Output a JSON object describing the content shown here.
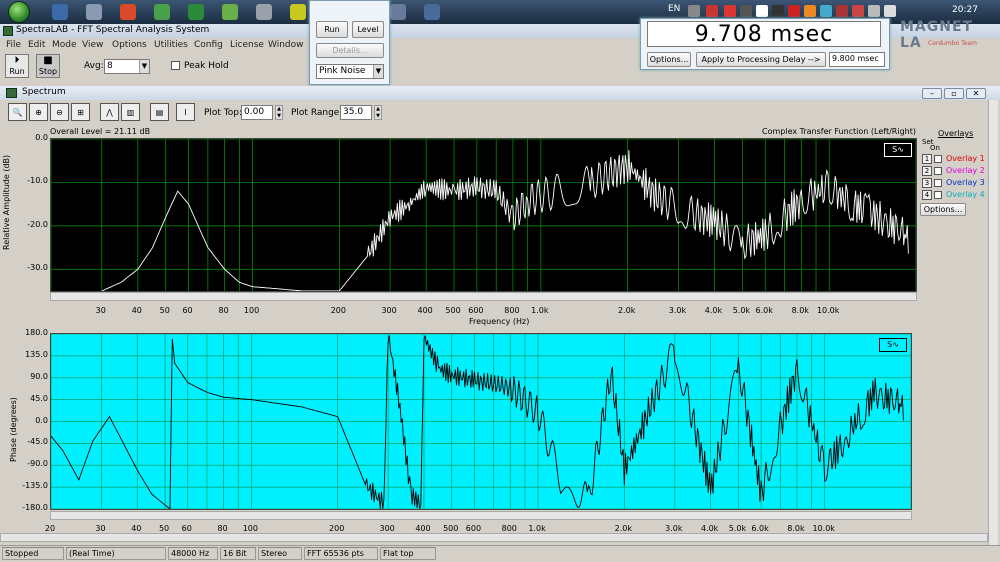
{
  "taskbar": {
    "lang": "EN",
    "clock": "20:27"
  },
  "brand": {
    "name": "MAGNET LA",
    "sub": "Cerdumbo Team"
  },
  "app": {
    "title": "SpectraLAB - FFT Spectral Analysis System"
  },
  "menu": [
    "File",
    "Edit",
    "Mode",
    "View",
    "Options",
    "Utilities",
    "Config",
    "License",
    "Window"
  ],
  "toolbar": {
    "run_label": "Run",
    "stop_label": "Stop",
    "avg_label": "Avg:",
    "avg_value": "8",
    "peak_hold_label": "Peak Hold"
  },
  "generator_popup": {
    "run_label": "Run",
    "level_label": "Level",
    "details_label": "Details...",
    "noise_value": "Pink Noise"
  },
  "delay_popup": {
    "value": "9.708 msec",
    "options_label": "Options...",
    "apply_label": "Apply to Processing Delay -->",
    "processing_delay": "9.800 msec"
  },
  "spectrum": {
    "title": "Spectrum",
    "plot_top_label": "Plot Top:",
    "plot_top_value": "0.00",
    "plot_range_label": "Plot Range:",
    "plot_range_value": "35.0",
    "overall_level": "Overall Level = 21.11 dB",
    "mode_label": "Complex Transfer Function (Left/Right)",
    "overlays_title": "Overlays",
    "set_label": "Set",
    "on_label": "On",
    "overlays": [
      {
        "num": "1",
        "label": "Overlay 1",
        "color": "#e00000"
      },
      {
        "num": "2",
        "label": "Overlay 2",
        "color": "#e000e0"
      },
      {
        "num": "3",
        "label": "Overlay 3",
        "color": "#0030c0"
      },
      {
        "num": "4",
        "label": "Overlay 4",
        "color": "#00b0c0"
      }
    ],
    "options_label": "Options..."
  },
  "chart_data": [
    {
      "type": "line",
      "ylabel": "Relative Amplitude (dB)",
      "xlabel": "Frequency (Hz)",
      "ylim": [
        -35,
        0
      ],
      "xlim": [
        20,
        20000
      ],
      "x_scale": "log",
      "yticks": [
        "0.0",
        "-10.0",
        "-20.0",
        "-30.0"
      ],
      "xticks": [
        "30",
        "40",
        "50",
        "60",
        "80",
        "100",
        "200",
        "300",
        "400",
        "500",
        "600",
        "800",
        "1.0k",
        "2.0k",
        "3.0k",
        "4.0k",
        "5.0k",
        "6.0k",
        "8.0k",
        "10.0k"
      ],
      "background": "#000000",
      "line_color": "#ffffff",
      "grid_color": "#00a000",
      "series": [
        {
          "x": [
            30,
            35,
            40,
            45,
            50,
            55,
            60,
            70,
            80,
            90,
            100,
            150,
            200,
            250,
            300,
            350,
            400,
            500,
            600,
            700,
            800,
            900,
            1000,
            1500,
            2000,
            2500,
            3000,
            4000,
            5000,
            6000,
            8000,
            10000,
            12000,
            15000,
            19000
          ],
          "values": [
            -35,
            -33,
            -30,
            -25,
            -18,
            -12,
            -15,
            -25,
            -30,
            -33,
            -34,
            -35,
            -35,
            -27,
            -18,
            -15,
            -11,
            -12,
            -11,
            -12,
            -18,
            -14,
            -13,
            -10,
            -6,
            -13,
            -16,
            -19,
            -24,
            -22,
            -14,
            -11,
            -15,
            -18,
            -23
          ]
        }
      ]
    },
    {
      "type": "line",
      "ylabel": "Phase (degrees)",
      "ylim": [
        -180,
        180
      ],
      "xlim": [
        20,
        20000
      ],
      "x_scale": "log",
      "yticks": [
        "180.0",
        "135.0",
        "90.0",
        "45.0",
        "0.0",
        "-45.0",
        "-90.0",
        "-135.0",
        "-180.0"
      ],
      "xticks": [
        "20",
        "30",
        "40",
        "50",
        "60",
        "80",
        "100",
        "200",
        "300",
        "400",
        "500",
        "600",
        "800",
        "1.0k",
        "2.0k",
        "3.0k",
        "4.0k",
        "5.0k",
        "6.0k",
        "8.0k",
        "10.0k"
      ],
      "background": "#00f0ff",
      "line_color": "#000000",
      "grid_color": "#00a060",
      "series": [
        {
          "x": [
            20,
            22,
            25,
            28,
            32,
            40,
            45,
            52,
            53,
            54,
            60,
            70,
            80,
            100,
            150,
            200,
            250,
            290,
            300,
            330,
            360,
            390,
            400,
            450,
            500,
            600,
            800,
            1000,
            1200,
            1500,
            1800,
            2000,
            3000,
            4000,
            5000,
            6000,
            8000,
            10000,
            15000,
            19000
          ],
          "values": [
            -30,
            -60,
            -120,
            -40,
            10,
            -100,
            -150,
            -180,
            170,
            120,
            80,
            60,
            50,
            45,
            30,
            10,
            -130,
            -170,
            180,
            30,
            -150,
            -170,
            175,
            110,
            95,
            85,
            70,
            20,
            -120,
            -160,
            100,
            -100,
            150,
            -140,
            120,
            -150,
            110,
            -100,
            60,
            30
          ]
        }
      ]
    }
  ],
  "status": {
    "state": "Stopped",
    "mode": "(Real Time)",
    "rate": "48000 Hz",
    "bits": "16 Bit",
    "channels": "Stereo",
    "fft": "FFT 65536 pts",
    "window": "Flat top"
  }
}
